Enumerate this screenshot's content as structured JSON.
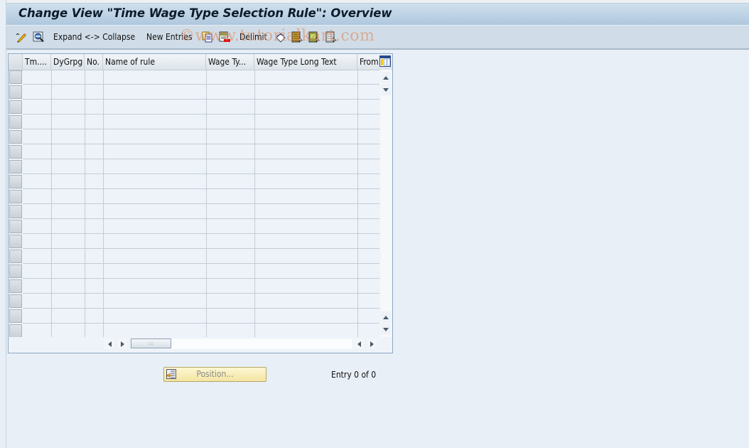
{
  "window": {
    "title": "Change View \"Time Wage Type Selection Rule\": Overview"
  },
  "toolbar": {
    "items": [
      {
        "name": "display-change-icon",
        "type": "icon"
      },
      {
        "name": "details-icon",
        "type": "icon"
      },
      {
        "label": "Expand <-> Collapse",
        "type": "text"
      },
      {
        "label": "New Entries",
        "type": "text"
      },
      {
        "name": "copy-as-icon",
        "type": "icon"
      },
      {
        "name": "delete-icon",
        "type": "icon"
      },
      {
        "label": "Delimit",
        "type": "text"
      },
      {
        "name": "undo-change-icon",
        "type": "icon"
      },
      {
        "name": "select-all-icon",
        "type": "icon"
      },
      {
        "name": "select-block-icon",
        "type": "icon"
      },
      {
        "name": "deselect-all-icon",
        "type": "icon"
      }
    ],
    "expand_collapse_label": "Expand <-> Collapse",
    "new_entries_label": "New Entries",
    "delimit_label": "Delimit",
    "watermark": "©www.tutorialkart.com"
  },
  "table": {
    "columns": [
      {
        "key": "tm",
        "label": "Tm...."
      },
      {
        "key": "dygrpg",
        "label": "DyGrpg"
      },
      {
        "key": "no",
        "label": "No."
      },
      {
        "key": "name_of_rule",
        "label": "Name of rule"
      },
      {
        "key": "wage_type",
        "label": "Wage Ty..."
      },
      {
        "key": "wage_type_long_text",
        "label": "Wage Type Long Text"
      },
      {
        "key": "from",
        "label": "From"
      }
    ],
    "row_count": 18,
    "rows": [],
    "column_settings_icon": "table-settings-icon"
  },
  "footer": {
    "position_button_label": "Position...",
    "entry_text": "Entry 0 of 0"
  },
  "colors": {
    "title_bar": "#afc7dd",
    "toolbar_bg": "#d0dde8",
    "page_bg": "#e8eff7",
    "table_border": "#8ea9c3",
    "position_button": "#f4e5a2"
  }
}
